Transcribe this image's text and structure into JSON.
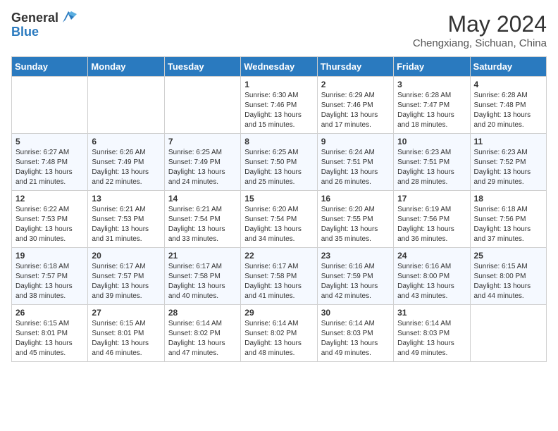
{
  "header": {
    "logo_general": "General",
    "logo_blue": "Blue",
    "month_year": "May 2024",
    "location": "Chengxiang, Sichuan, China"
  },
  "weekdays": [
    "Sunday",
    "Monday",
    "Tuesday",
    "Wednesday",
    "Thursday",
    "Friday",
    "Saturday"
  ],
  "weeks": [
    [
      {
        "day": "",
        "info": ""
      },
      {
        "day": "",
        "info": ""
      },
      {
        "day": "",
        "info": ""
      },
      {
        "day": "1",
        "info": "Sunrise: 6:30 AM\nSunset: 7:46 PM\nDaylight: 13 hours and 15 minutes."
      },
      {
        "day": "2",
        "info": "Sunrise: 6:29 AM\nSunset: 7:46 PM\nDaylight: 13 hours and 17 minutes."
      },
      {
        "day": "3",
        "info": "Sunrise: 6:28 AM\nSunset: 7:47 PM\nDaylight: 13 hours and 18 minutes."
      },
      {
        "day": "4",
        "info": "Sunrise: 6:28 AM\nSunset: 7:48 PM\nDaylight: 13 hours and 20 minutes."
      }
    ],
    [
      {
        "day": "5",
        "info": "Sunrise: 6:27 AM\nSunset: 7:48 PM\nDaylight: 13 hours and 21 minutes."
      },
      {
        "day": "6",
        "info": "Sunrise: 6:26 AM\nSunset: 7:49 PM\nDaylight: 13 hours and 22 minutes."
      },
      {
        "day": "7",
        "info": "Sunrise: 6:25 AM\nSunset: 7:49 PM\nDaylight: 13 hours and 24 minutes."
      },
      {
        "day": "8",
        "info": "Sunrise: 6:25 AM\nSunset: 7:50 PM\nDaylight: 13 hours and 25 minutes."
      },
      {
        "day": "9",
        "info": "Sunrise: 6:24 AM\nSunset: 7:51 PM\nDaylight: 13 hours and 26 minutes."
      },
      {
        "day": "10",
        "info": "Sunrise: 6:23 AM\nSunset: 7:51 PM\nDaylight: 13 hours and 28 minutes."
      },
      {
        "day": "11",
        "info": "Sunrise: 6:23 AM\nSunset: 7:52 PM\nDaylight: 13 hours and 29 minutes."
      }
    ],
    [
      {
        "day": "12",
        "info": "Sunrise: 6:22 AM\nSunset: 7:53 PM\nDaylight: 13 hours and 30 minutes."
      },
      {
        "day": "13",
        "info": "Sunrise: 6:21 AM\nSunset: 7:53 PM\nDaylight: 13 hours and 31 minutes."
      },
      {
        "day": "14",
        "info": "Sunrise: 6:21 AM\nSunset: 7:54 PM\nDaylight: 13 hours and 33 minutes."
      },
      {
        "day": "15",
        "info": "Sunrise: 6:20 AM\nSunset: 7:54 PM\nDaylight: 13 hours and 34 minutes."
      },
      {
        "day": "16",
        "info": "Sunrise: 6:20 AM\nSunset: 7:55 PM\nDaylight: 13 hours and 35 minutes."
      },
      {
        "day": "17",
        "info": "Sunrise: 6:19 AM\nSunset: 7:56 PM\nDaylight: 13 hours and 36 minutes."
      },
      {
        "day": "18",
        "info": "Sunrise: 6:18 AM\nSunset: 7:56 PM\nDaylight: 13 hours and 37 minutes."
      }
    ],
    [
      {
        "day": "19",
        "info": "Sunrise: 6:18 AM\nSunset: 7:57 PM\nDaylight: 13 hours and 38 minutes."
      },
      {
        "day": "20",
        "info": "Sunrise: 6:17 AM\nSunset: 7:57 PM\nDaylight: 13 hours and 39 minutes."
      },
      {
        "day": "21",
        "info": "Sunrise: 6:17 AM\nSunset: 7:58 PM\nDaylight: 13 hours and 40 minutes."
      },
      {
        "day": "22",
        "info": "Sunrise: 6:17 AM\nSunset: 7:58 PM\nDaylight: 13 hours and 41 minutes."
      },
      {
        "day": "23",
        "info": "Sunrise: 6:16 AM\nSunset: 7:59 PM\nDaylight: 13 hours and 42 minutes."
      },
      {
        "day": "24",
        "info": "Sunrise: 6:16 AM\nSunset: 8:00 PM\nDaylight: 13 hours and 43 minutes."
      },
      {
        "day": "25",
        "info": "Sunrise: 6:15 AM\nSunset: 8:00 PM\nDaylight: 13 hours and 44 minutes."
      }
    ],
    [
      {
        "day": "26",
        "info": "Sunrise: 6:15 AM\nSunset: 8:01 PM\nDaylight: 13 hours and 45 minutes."
      },
      {
        "day": "27",
        "info": "Sunrise: 6:15 AM\nSunset: 8:01 PM\nDaylight: 13 hours and 46 minutes."
      },
      {
        "day": "28",
        "info": "Sunrise: 6:14 AM\nSunset: 8:02 PM\nDaylight: 13 hours and 47 minutes."
      },
      {
        "day": "29",
        "info": "Sunrise: 6:14 AM\nSunset: 8:02 PM\nDaylight: 13 hours and 48 minutes."
      },
      {
        "day": "30",
        "info": "Sunrise: 6:14 AM\nSunset: 8:03 PM\nDaylight: 13 hours and 49 minutes."
      },
      {
        "day": "31",
        "info": "Sunrise: 6:14 AM\nSunset: 8:03 PM\nDaylight: 13 hours and 49 minutes."
      },
      {
        "day": "",
        "info": ""
      }
    ]
  ]
}
